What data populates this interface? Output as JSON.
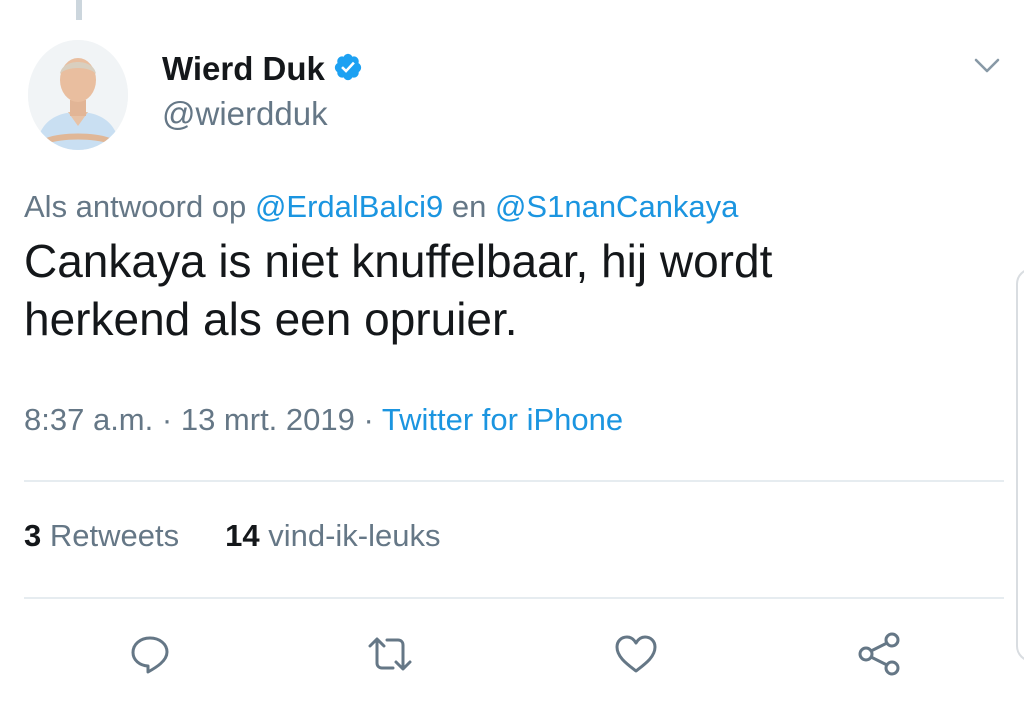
{
  "author": {
    "name": "Wierd Duk",
    "handle": "@wierdduk",
    "verified": true
  },
  "reply": {
    "prefix": "Als antwoord op",
    "mention1": "@ErdalBalci9",
    "joiner": "en",
    "mention2": "@S1nanCankaya"
  },
  "tweet": {
    "line1": "Cankaya is niet knuffelbaar, hij wordt",
    "line2": "herkend als een opruier."
  },
  "meta": {
    "time": "8:37 a.m.",
    "sep1": "·",
    "date": "13 mrt. 2019",
    "sep2": "·",
    "source": "Twitter for iPhone"
  },
  "stats": {
    "retweets_count": "3",
    "retweets_label": "Retweets",
    "likes_count": "14",
    "likes_label": "vind-ik-leuks"
  },
  "colors": {
    "accent": "#1b95e0",
    "muted": "#657786",
    "text": "#14171a",
    "divider": "#e6ecf0"
  },
  "icons": [
    "verified-badge-icon",
    "chevron-down-icon",
    "reply-icon",
    "retweet-icon",
    "like-icon",
    "share-icon"
  ]
}
